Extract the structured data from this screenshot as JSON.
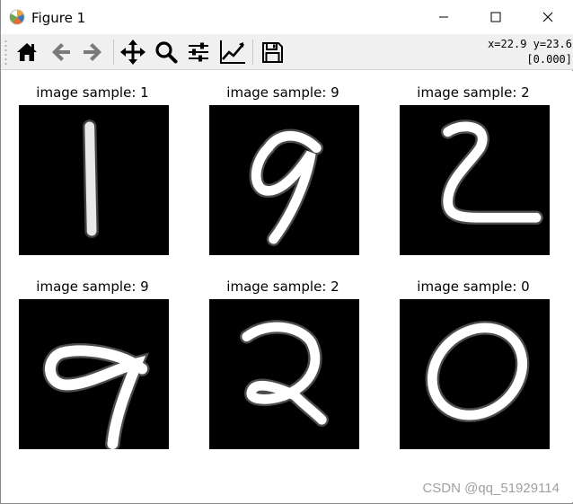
{
  "window": {
    "title": "Figure 1",
    "icon": "matplotlib-logo-icon",
    "controls": [
      "minimize-icon",
      "maximize-icon",
      "close-icon"
    ]
  },
  "toolbar": {
    "buttons": [
      {
        "name": "home",
        "icon": "home-icon"
      },
      {
        "name": "back",
        "icon": "arrow-left-icon"
      },
      {
        "name": "forward",
        "icon": "arrow-right-icon"
      },
      {
        "name": "pan",
        "icon": "move-icon"
      },
      {
        "name": "zoom",
        "icon": "zoom-icon"
      },
      {
        "name": "configure-subplots",
        "icon": "sliders-icon"
      },
      {
        "name": "edit-axis",
        "icon": "line-chart-icon"
      },
      {
        "name": "save",
        "icon": "save-icon"
      }
    ],
    "coords_line1": "x=22.9 y=23.6",
    "coords_line2": "[0.000]"
  },
  "figure": {
    "subplots": [
      {
        "title": "image sample: 1"
      },
      {
        "title": "image sample: 9"
      },
      {
        "title": "image sample: 2"
      },
      {
        "title": "image sample: 9"
      },
      {
        "title": "image sample: 2"
      },
      {
        "title": "image sample: 0"
      }
    ],
    "image_background": "#000000",
    "image_foreground": "#ffffff"
  },
  "watermark": "CSDN @qq_51929114"
}
